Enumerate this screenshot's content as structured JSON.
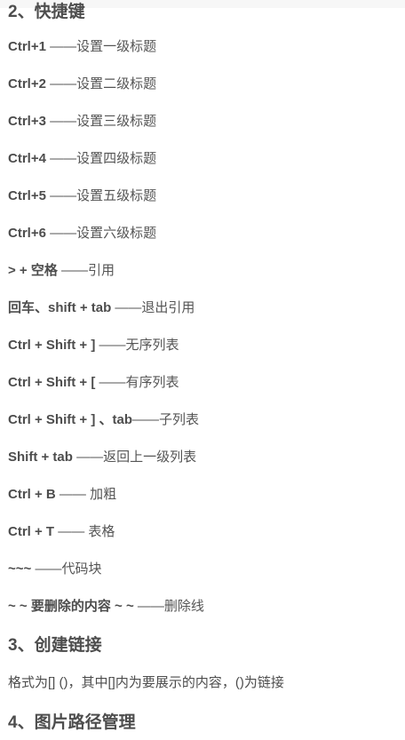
{
  "section2": {
    "title": "2、快捷键",
    "items": [
      {
        "key": "Ctrl+1",
        "desc": " ——设置一级标题"
      },
      {
        "key": "Ctrl+2",
        "desc": " ——设置二级标题"
      },
      {
        "key": "Ctrl+3",
        "desc": " ——设置三级标题"
      },
      {
        "key": "Ctrl+4",
        "desc": " ——设置四级标题"
      },
      {
        "key": "Ctrl+5",
        "desc": " ——设置五级标题"
      },
      {
        "key": "Ctrl+6",
        "desc": " ——设置六级标题"
      },
      {
        "key": "> + 空格",
        "desc": " ——引用"
      },
      {
        "key": "回车、shift + tab",
        "desc": " ——退出引用"
      },
      {
        "key": "Ctrl + Shift + ]",
        "desc": " ——无序列表"
      },
      {
        "key": "Ctrl + Shift + [",
        "desc": " ——有序列表"
      },
      {
        "key": "Ctrl + Shift + ] 、tab",
        "desc": "——子列表"
      },
      {
        "key": "Shift + tab",
        "desc": " ——返回上一级列表"
      },
      {
        "key": "Ctrl + B",
        "desc": " —— 加粗"
      },
      {
        "key": "Ctrl + T",
        "desc": " —— 表格"
      },
      {
        "key": "~~~",
        "desc": " ——代码块"
      },
      {
        "key": "~ ~ 要删除的内容 ~ ~",
        "desc": " ——删除线"
      }
    ]
  },
  "section3": {
    "title": "3、创建链接",
    "text": "格式为[] ()，其中[]内为要展示的内容，()为链接"
  },
  "section4": {
    "title": "4、图片路径管理"
  }
}
